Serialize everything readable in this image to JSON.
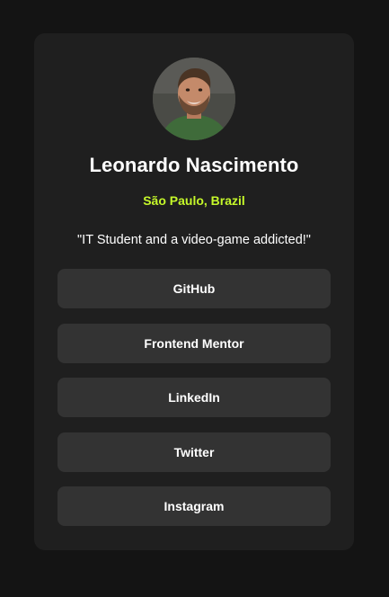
{
  "profile": {
    "avatar_alt": "Leonardo Nascimento",
    "name": "Leonardo Nascimento",
    "location": "São Paulo, Brazil",
    "bio": "\"IT Student and a video-game addicted!\""
  },
  "links": [
    {
      "label": "GitHub"
    },
    {
      "label": "Frontend Mentor"
    },
    {
      "label": "LinkedIn"
    },
    {
      "label": "Twitter"
    },
    {
      "label": "Instagram"
    }
  ],
  "colors": {
    "background": "#141414",
    "card": "#1f1f1f",
    "button": "#333333",
    "accent": "#c5f82a",
    "text": "#ffffff"
  }
}
